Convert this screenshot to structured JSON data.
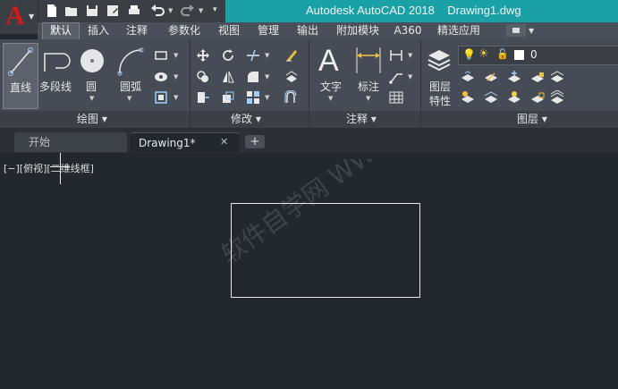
{
  "title": "Autodesk AutoCAD 2018    Drawing1.dwg",
  "ribbon_tabs": [
    "默认",
    "插入",
    "注释",
    "参数化",
    "视图",
    "管理",
    "输出",
    "附加模块",
    "A360",
    "精选应用"
  ],
  "draw_panel": {
    "line": "直线",
    "polyline": "多段线",
    "circle": "圆",
    "arc": "圆弧",
    "title": "绘图 ▾"
  },
  "modify_panel": {
    "title": "修改 ▾"
  },
  "annotation_panel": {
    "text": "文字",
    "dimension": "标注",
    "title": "注释 ▾"
  },
  "layers_panel": {
    "properties_1": "图层",
    "properties_2": "特性",
    "layer_name": "0",
    "title": "图层 ▾"
  },
  "doc_tabs": {
    "start": "开始",
    "drawing": "Drawing1*",
    "close": "✕",
    "add": "+"
  },
  "viewport": {
    "controls": "[−][俯视][二维线框]"
  },
  "watermark": "软件自学网 WWW.RJZXW.COM",
  "colors": {
    "title_bar": "#19a1a6",
    "canvas": "#212830",
    "ribbon": "#464c55",
    "logo": "#d01b1b"
  }
}
